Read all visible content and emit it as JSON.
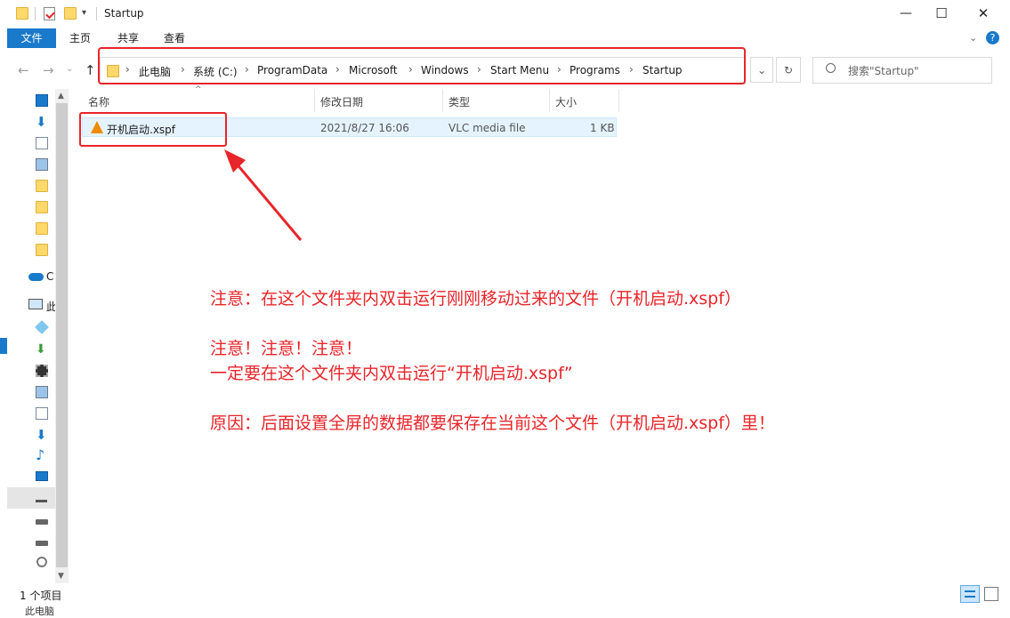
{
  "window": {
    "title": "Startup",
    "controls": {
      "minimize": "—",
      "maximize": "☐",
      "close": "✕"
    }
  },
  "ribbon": {
    "tabs": [
      "文件",
      "主页",
      "共享",
      "查看"
    ]
  },
  "address": {
    "crumbs": [
      "此电脑",
      "系统 (C:)",
      "ProgramData",
      "Microsoft",
      "Windows",
      "Start Menu",
      "Programs",
      "Startup"
    ],
    "search_placeholder": "搜索\"Startup\""
  },
  "nav": {
    "partial_labels": [
      "C",
      "此"
    ],
    "icons": [
      "desktop-icon",
      "download-icon",
      "document-icon",
      "picture-icon",
      "folder-icon",
      "folder-icon",
      "folder-icon",
      "folder-icon",
      "onedrive-icon",
      "this-pc-icon",
      "3d-objects-icon",
      "download-icon",
      "video-icon",
      "picture-icon",
      "document-icon",
      "download-icon",
      "music-icon",
      "desktop-icon",
      "network-drive-icon",
      "drive-icon",
      "drive-icon",
      "cd-drive-icon"
    ]
  },
  "columns": {
    "name": "名称",
    "modified": "修改日期",
    "type": "类型",
    "size": "大小"
  },
  "files": [
    {
      "name": "开机启动.xspf",
      "modified": "2021/8/27 16:06",
      "type": "VLC media file",
      "size": "1 KB",
      "icon": "vlc-icon"
    }
  ],
  "notes": {
    "line1": "注意：在这个文件夹内双击运行刚刚移动过来的文件（开机启动.xspf）",
    "line2": "注意！注意！注意！",
    "line3": "一定要在这个文件夹内双击运行“开机启动.xspf”",
    "line4": "原因：后面设置全屏的数据都要保存在当前这个文件（开机启动.xspf）里！"
  },
  "status": {
    "item_count": "1 个项目",
    "taskbar_partial": "此电脑"
  },
  "colors": {
    "accent": "#1979ca",
    "annotation": "#e8252a",
    "selection": "#e5f3ff"
  }
}
